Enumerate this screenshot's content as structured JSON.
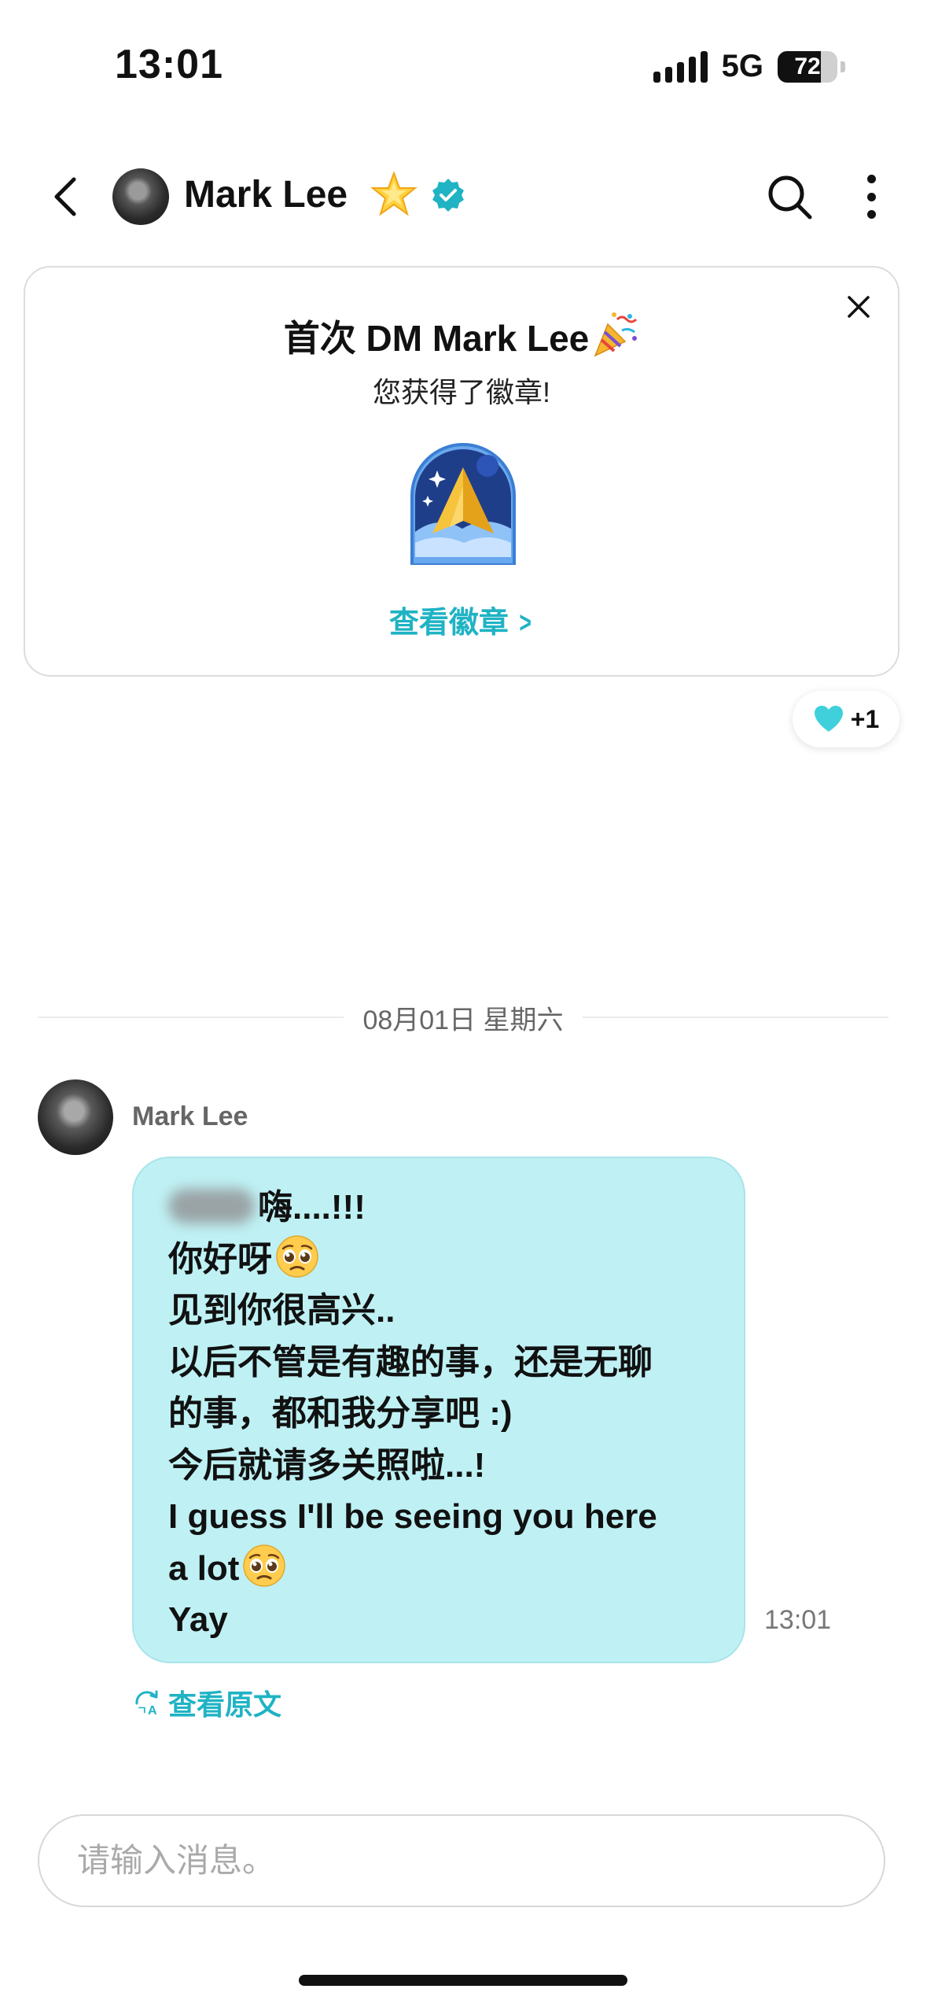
{
  "status_bar": {
    "time": "13:01",
    "network": "5G",
    "battery": "72",
    "battery_level": 0.72
  },
  "header": {
    "name": "Mark Lee"
  },
  "badge_card": {
    "title": "首次 DM Mark Lee",
    "subtitle": "您获得了徽章!",
    "view_link": "查看徽章"
  },
  "reaction": {
    "count": "+1"
  },
  "date_divider": "08月01日 星期六",
  "message": {
    "sender": "Mark Lee",
    "lines": [
      "嗨....!!!",
      "你好呀",
      "见到你很高兴..",
      "以后不管是有趣的事，还是无聊",
      "的事，都和我分享吧 :)",
      "今后就请多关照啦...!",
      "I guess I'll be seeing you here",
      "a lot",
      "Yay"
    ],
    "time": "13:01",
    "view_original": "查看原文"
  },
  "input": {
    "placeholder": "请输入消息。"
  },
  "colors": {
    "accent": "#1fb3c4",
    "bubble": "#bff1f4"
  },
  "icons": [
    "back-arrow-icon",
    "star-icon",
    "verified-icon",
    "search-icon",
    "more-icon",
    "close-icon",
    "party-popper-icon",
    "heart-icon",
    "pleading-face-icon",
    "translate-icon"
  ]
}
